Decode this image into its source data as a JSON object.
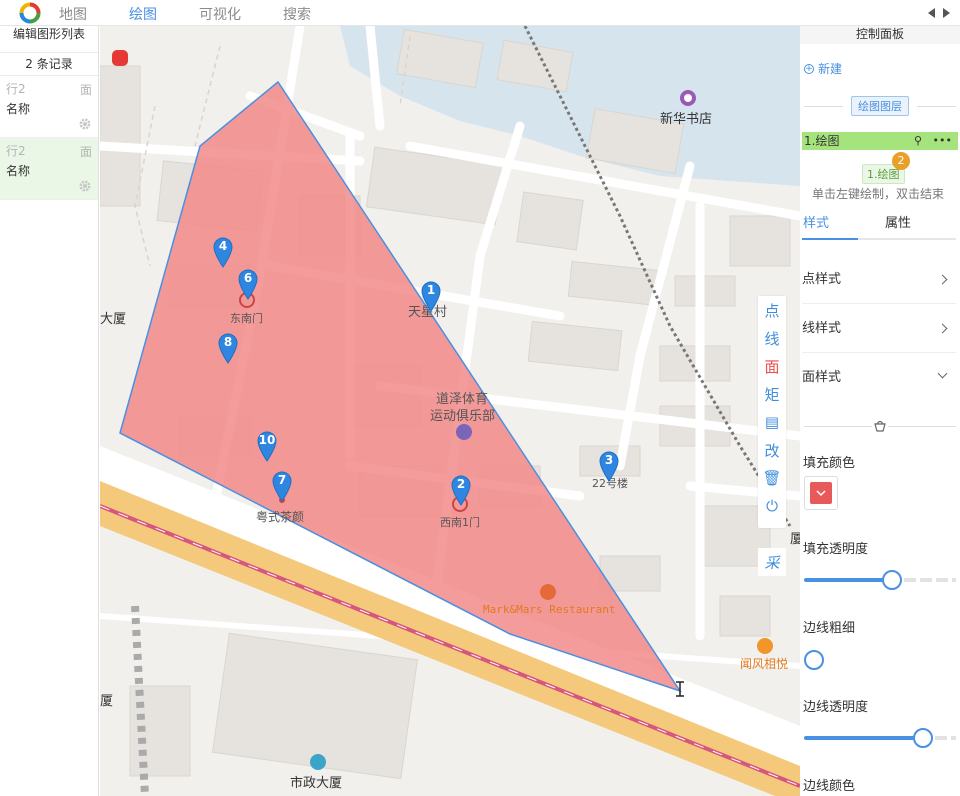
{
  "topbar": {
    "tabs": [
      {
        "label": "地图",
        "active": false
      },
      {
        "label": "绘图",
        "active": true
      },
      {
        "label": "可视化",
        "active": false
      },
      {
        "label": "搜索",
        "active": false
      }
    ]
  },
  "left_panel": {
    "title": "编辑图形列表",
    "count": "2 条记录",
    "records": [
      {
        "row": "行2",
        "type": "面",
        "name": "名称",
        "selected": false
      },
      {
        "row": "行2",
        "type": "面",
        "name": "名称",
        "selected": true
      }
    ]
  },
  "map": {
    "labels": {
      "bookstore": "新华书店",
      "tianxing": "天星村",
      "dongnanmen": "东南门",
      "gym1": "道泽体育",
      "gym2": "运动俱乐部",
      "no22": "22号楼",
      "ximen": "西南1门",
      "tea": "粤式茶颜",
      "restaurant": "Mark&Mars Restaurant",
      "wenfeng": "闻风相悦",
      "shizheng": "市政大厦",
      "building_left1": "大厦",
      "building_left2": "厦",
      "building_right": "厦"
    },
    "markers": [
      "1",
      "2",
      "3",
      "4",
      "6",
      "7",
      "8",
      "10"
    ],
    "polygon_color": "#f28a8a",
    "polygon_stroke": "#4a8fe0"
  },
  "draw_toolbar": {
    "point": "点",
    "line": "线",
    "polygon": "面",
    "rect": "矩",
    "text": "▤",
    "edit": "改",
    "delete": "🗑",
    "power": "⏻",
    "collect": "采"
  },
  "right_panel": {
    "title": "控制面板",
    "new_label": "新建",
    "layer_section": "绘图图层",
    "layer_name": "1.绘图",
    "layer_chip": "1.绘图",
    "badge": "2",
    "hint": "单击左键绘制，双击结束",
    "tabs": {
      "style": "样式",
      "props": "属性"
    },
    "accordions": {
      "point": "点样式",
      "line": "线样式",
      "polygon": "面样式"
    },
    "fill_color_label": "填充颜色",
    "fill_color": "#e85a5a",
    "fill_opacity_label": "填充透明度",
    "fill_opacity": 0.58,
    "stroke_width_label": "边线粗细",
    "stroke_width": 0.0,
    "stroke_opacity_label": "边线透明度",
    "stroke_opacity": 0.78,
    "stroke_color_label": "边线颜色"
  }
}
